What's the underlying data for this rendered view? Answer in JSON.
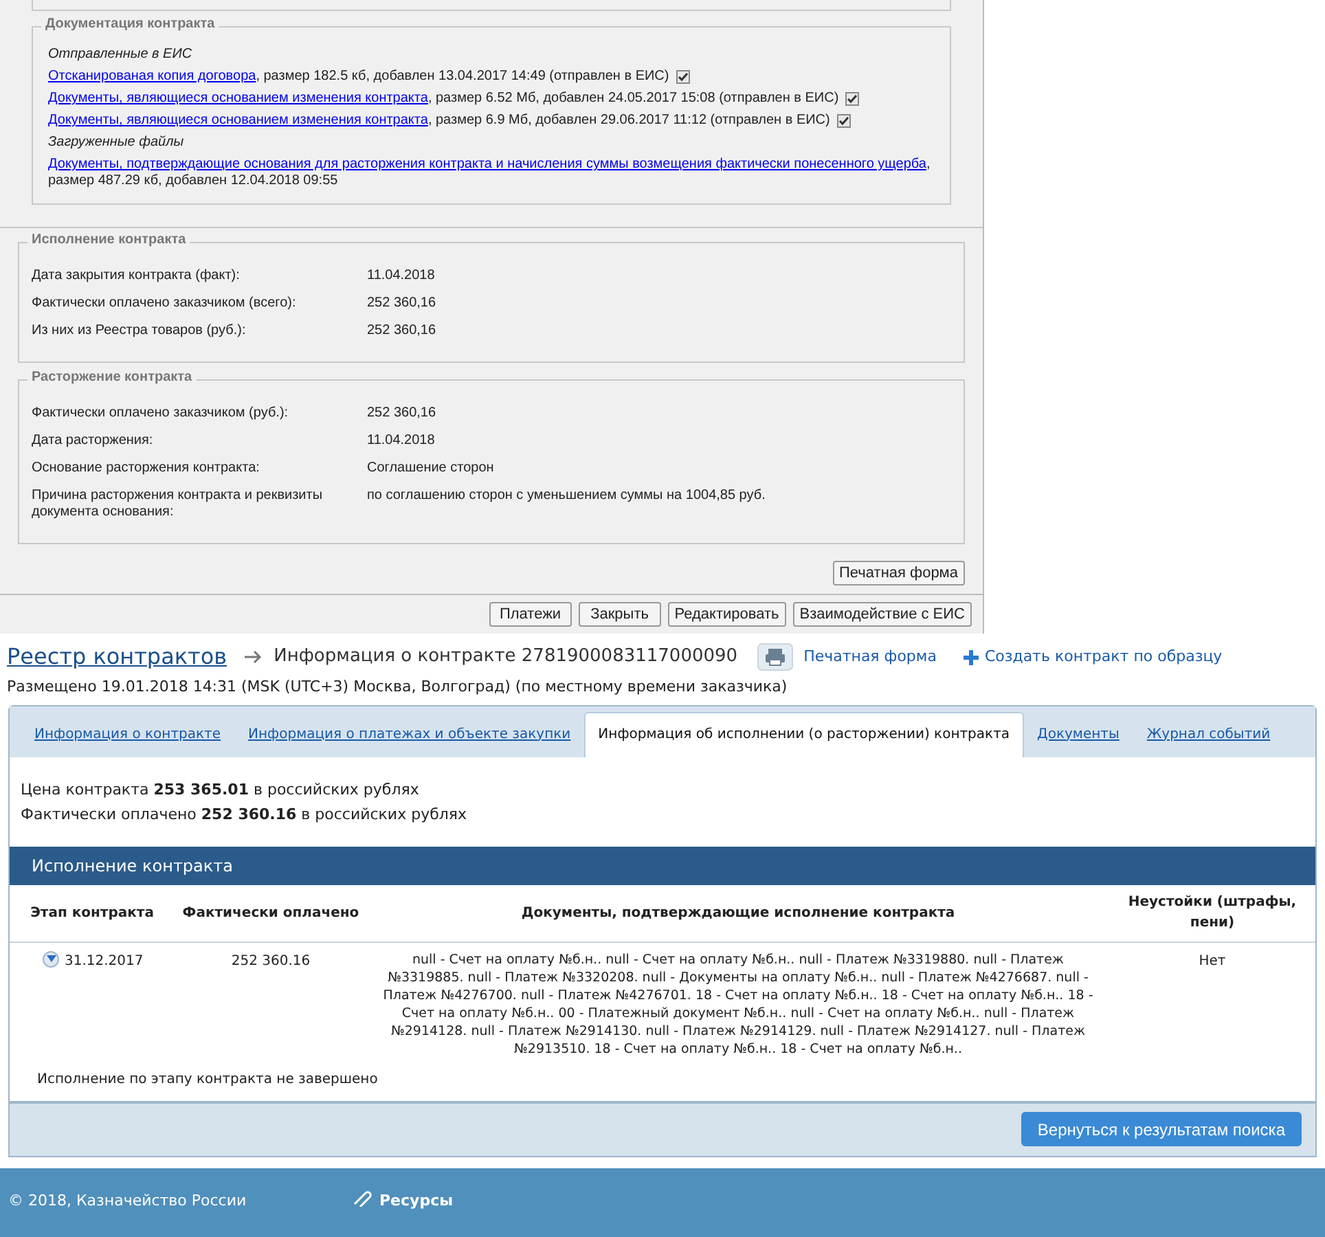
{
  "documentation": {
    "title": "Документация контракта",
    "sections": [
      {
        "heading": "Отправленные в ЕИС",
        "files": [
          {
            "link": "Отсканированая копия договора",
            "details": ", размер 182.5 кб, добавлен 13.04.2017 14:49 (отправлен в ЕИС)",
            "checked": true
          },
          {
            "link": "Документы, являющиеся основанием изменения контракта",
            "details": ", размер 6.52 Мб, добавлен 24.05.2017 15:08 (отправлен в ЕИС)",
            "checked": true
          },
          {
            "link": "Документы, являющиеся основанием изменения контракта",
            "details": ", размер 6.9 Мб, добавлен 29.06.2017 11:12 (отправлен в ЕИС)",
            "checked": true
          }
        ]
      },
      {
        "heading": "Загруженные файлы",
        "files": [
          {
            "link": "Документы, подтверждающие основания для расторжения контракта и начисления суммы возмещения фактически понесенного ущерба",
            "details": ", размер 487.29 кб, добавлен 12.04.2018 09:55"
          }
        ]
      }
    ]
  },
  "execution": {
    "title": "Исполнение контракта",
    "fields": [
      {
        "label": "Дата закрытия контракта (факт):",
        "value": "11.04.2018"
      },
      {
        "label": "Фактически оплачено заказчиком (всего):",
        "value": "252 360,16"
      },
      {
        "label": "Из них из Реестра товаров (руб.):",
        "value": "252 360,16"
      }
    ]
  },
  "termination": {
    "title": "Расторжение контракта",
    "fields": [
      {
        "label": "Фактически оплачено заказчиком (руб.):",
        "value": "252 360,16"
      },
      {
        "label": "Дата расторжения:",
        "value": "11.04.2018"
      },
      {
        "label": "Основание расторжения контракта:",
        "value": "Соглашение сторон"
      },
      {
        "label": "Причина расторжения контракта и реквизиты документа основания:",
        "value": "по соглашению сторон с уменьшением суммы на 1004,85 руб."
      }
    ]
  },
  "print_button": "Печатная форма",
  "dialog_buttons": [
    "Платежи",
    "Закрыть",
    "Редактировать",
    "Взаимодействие с ЕИС"
  ],
  "page": {
    "breadcrumb": "Реестр контрактов",
    "title": "Информация о контракте 2781900083117000090",
    "print_link": "Печатная форма",
    "create_link": "Создать контракт по образцу",
    "posted": "Размещено 19.01.2018 14:31 (MSK (UTC+3) Москва, Волгоград) (по местному времени заказчика)"
  },
  "tabs": [
    {
      "label": "Информация о контракте",
      "selected": false
    },
    {
      "label": "Информация о платежах и объекте закупки",
      "selected": false
    },
    {
      "label": "Информация об исполнении (о расторжении) контракта",
      "selected": true
    },
    {
      "label": "Документы",
      "selected": false
    },
    {
      "label": "Журнал событий",
      "selected": false
    }
  ],
  "summary": [
    "Цена контракта **253 365.01** в российских рублях",
    "Фактически оплачено **252 360.16** в российских рублях"
  ],
  "execution_table": {
    "title": "Исполнение контракта",
    "columns": [
      "Этап контракта",
      "Фактически оплачено",
      "Документы, подтверждающие исполнение контракта",
      "Неустойки (штрафы, пени)"
    ],
    "rows": [
      {
        "expanded": false,
        "stage": "31.12.2017",
        "paid": "252 360.16",
        "documents": "null - Счет на оплату №б.н.. null - Счет на оплату №б.н.. null - Платеж №3319880. null - Платеж №3319885. null - Платеж №3320208. null - Документы на оплату №б.н.. null - Платеж №4276687. null - Платеж №4276700. null - Платеж №4276701. 18 - Счет на оплату №б.н.. 18 - Счет на оплату №б.н.. 18 - Счет на оплату №б.н.. 00 - Платежный документ №б.н.. null - Счет на оплату №б.н.. null - Платеж №2914128. null - Платеж №2914130. null - Платеж №2914129. null - Платеж №2914127. null - Платеж №2913510. 18 - Счет на оплату №б.н.. 18 - Счет на оплату №б.н..",
        "penalties": "Нет"
      }
    ],
    "note": "Исполнение по этапу контракта не завершено"
  },
  "back_button": "Вернуться к результатам поиска",
  "footer": {
    "copyright": "© 2018, Казначейство России",
    "resources": "Ресурсы"
  }
}
